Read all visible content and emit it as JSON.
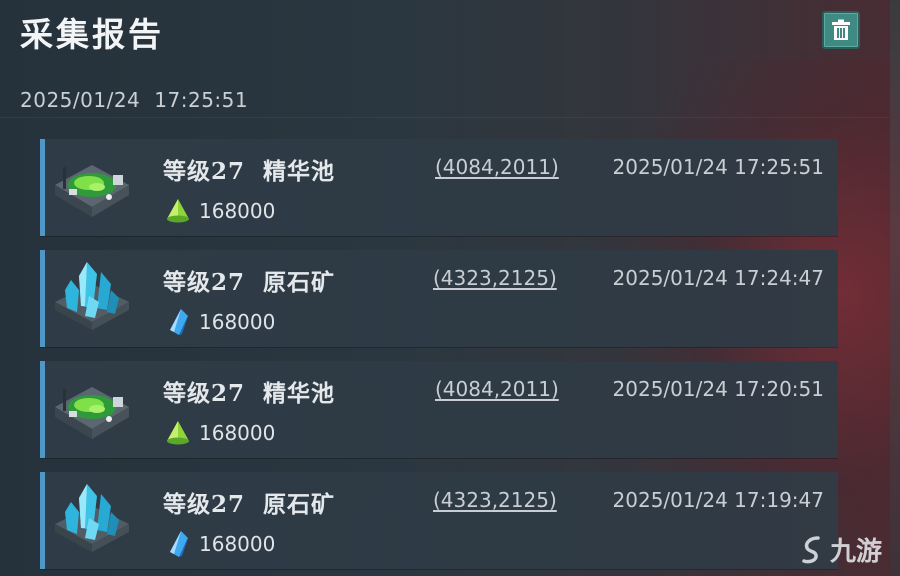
{
  "header": {
    "title": "采集报告",
    "date": "2025/01/24",
    "time": "17:25:51",
    "delete_icon": "trash-icon"
  },
  "colors": {
    "accent_bar": "#4e97c6",
    "delete_button": "#3f8a82"
  },
  "reports": [
    {
      "title": "等级27  精华池",
      "coords": "(4084,2011)",
      "timestamp": "2025/01/24 17:25:51",
      "resource_icon": "essence-icon",
      "amount": "168000",
      "thumbnail": "essence-pool-thumbnail"
    },
    {
      "title": "等级27  原石矿",
      "coords": "(4323,2125)",
      "timestamp": "2025/01/24 17:24:47",
      "resource_icon": "crystal-icon",
      "amount": "168000",
      "thumbnail": "crystal-mine-thumbnail"
    },
    {
      "title": "等级27  精华池",
      "coords": "(4084,2011)",
      "timestamp": "2025/01/24 17:20:51",
      "resource_icon": "essence-icon",
      "amount": "168000",
      "thumbnail": "essence-pool-thumbnail"
    },
    {
      "title": "等级27  原石矿",
      "coords": "(4323,2125)",
      "timestamp": "2025/01/24 17:19:47",
      "resource_icon": "crystal-icon",
      "amount": "168000",
      "thumbnail": "crystal-mine-thumbnail"
    }
  ],
  "watermark": {
    "text": "九游",
    "icon": "jiuyou-logo-icon"
  }
}
